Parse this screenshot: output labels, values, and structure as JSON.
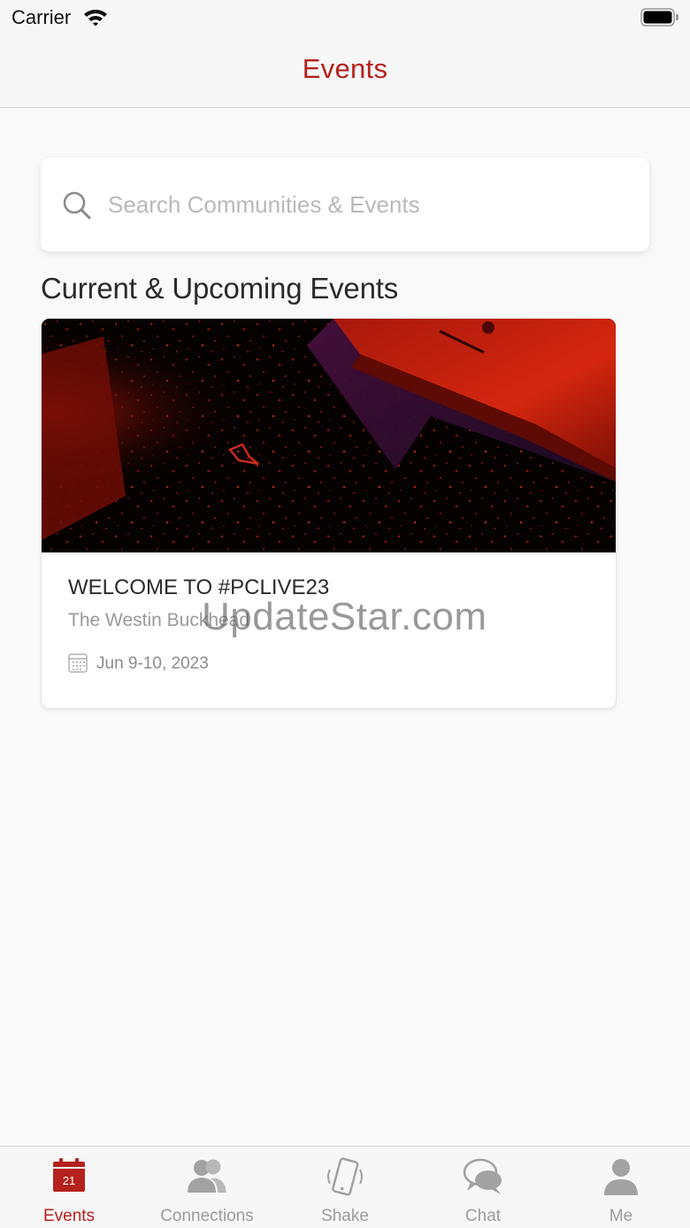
{
  "status_bar": {
    "carrier": "Carrier"
  },
  "header": {
    "title": "Events"
  },
  "search": {
    "placeholder": "Search Communities & Events",
    "value": ""
  },
  "section": {
    "title": "Current & Upcoming Events"
  },
  "events": [
    {
      "title": "WELCOME TO #PCLIVE23",
      "venue": "The Westin Buckhead",
      "date": "Jun  9-10, 2023"
    }
  ],
  "watermark": "UpdateStar.com",
  "tab_bar": {
    "tabs": [
      {
        "label": "Events",
        "icon": "calendar-icon",
        "badge": "21",
        "active": true
      },
      {
        "label": "Connections",
        "icon": "people-icon",
        "active": false
      },
      {
        "label": "Shake",
        "icon": "shake-phone-icon",
        "active": false
      },
      {
        "label": "Chat",
        "icon": "chat-bubbles-icon",
        "active": false
      },
      {
        "label": "Me",
        "icon": "person-icon",
        "active": false
      }
    ]
  },
  "colors": {
    "accent": "#b5211c",
    "inactive": "#9b9b9b",
    "background": "#f9f9f9"
  }
}
